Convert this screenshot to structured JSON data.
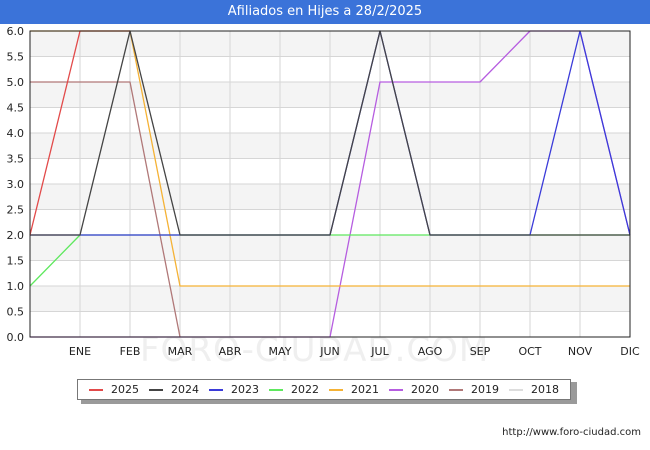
{
  "header": {
    "title": "Afiliados en Hijes a 28/2/2025"
  },
  "watermark": "FORO-CIUDAD.COM",
  "footer": {
    "url": "http://www.foro-ciudad.com"
  },
  "chart_data": {
    "type": "line",
    "title": "Afiliados en Hijes a 28/2/2025",
    "xlabel": "",
    "ylabel": "",
    "x": [
      "",
      "ENE",
      "FEB",
      "MAR",
      "ABR",
      "MAY",
      "JUN",
      "JUL",
      "AGO",
      "SEP",
      "OCT",
      "NOV",
      "DIC"
    ],
    "ylim": [
      0,
      6
    ],
    "yticks": [
      "0.0",
      "0.5",
      "1.0",
      "1.5",
      "2.0",
      "2.5",
      "3.0",
      "3.5",
      "4.0",
      "4.5",
      "5.0",
      "5.5",
      "6.0"
    ],
    "grid": true,
    "legend_position": "bottom",
    "series": [
      {
        "name": "2018",
        "color": "#dddddd",
        "values": []
      },
      {
        "name": "2019",
        "color": "#b07878",
        "values": [
          5,
          5,
          5,
          0
        ]
      },
      {
        "name": "2020",
        "color": "#b65de0",
        "values": [
          0,
          0,
          0,
          0,
          0,
          0,
          0,
          5,
          5,
          5,
          6,
          6,
          2
        ]
      },
      {
        "name": "2021",
        "color": "#f5b235",
        "values": [
          6,
          6,
          6,
          1,
          1,
          1,
          1,
          1,
          1,
          1,
          1,
          1,
          1
        ]
      },
      {
        "name": "2022",
        "color": "#5ee85e",
        "values": [
          1,
          2,
          2,
          2,
          2,
          2,
          2,
          2,
          2,
          2,
          2,
          2,
          2
        ]
      },
      {
        "name": "2023",
        "color": "#3b3bd9",
        "values": [
          2,
          2,
          2,
          2,
          2,
          2,
          2,
          6,
          2,
          2,
          2,
          6,
          2
        ]
      },
      {
        "name": "2024",
        "color": "#444444",
        "values": [
          2,
          2,
          6,
          2,
          2,
          2,
          2,
          6,
          2,
          2,
          2,
          2,
          2
        ]
      },
      {
        "name": "2025",
        "color": "#e24a4a",
        "values": [
          2,
          6,
          6
        ]
      }
    ],
    "legend": [
      {
        "name": "2025",
        "color": "#e24a4a"
      },
      {
        "name": "2024",
        "color": "#444444"
      },
      {
        "name": "2023",
        "color": "#3b3bd9"
      },
      {
        "name": "2022",
        "color": "#5ee85e"
      },
      {
        "name": "2021",
        "color": "#f5b235"
      },
      {
        "name": "2020",
        "color": "#b65de0"
      },
      {
        "name": "2019",
        "color": "#b07878"
      },
      {
        "name": "2018",
        "color": "#dddddd"
      }
    ]
  }
}
